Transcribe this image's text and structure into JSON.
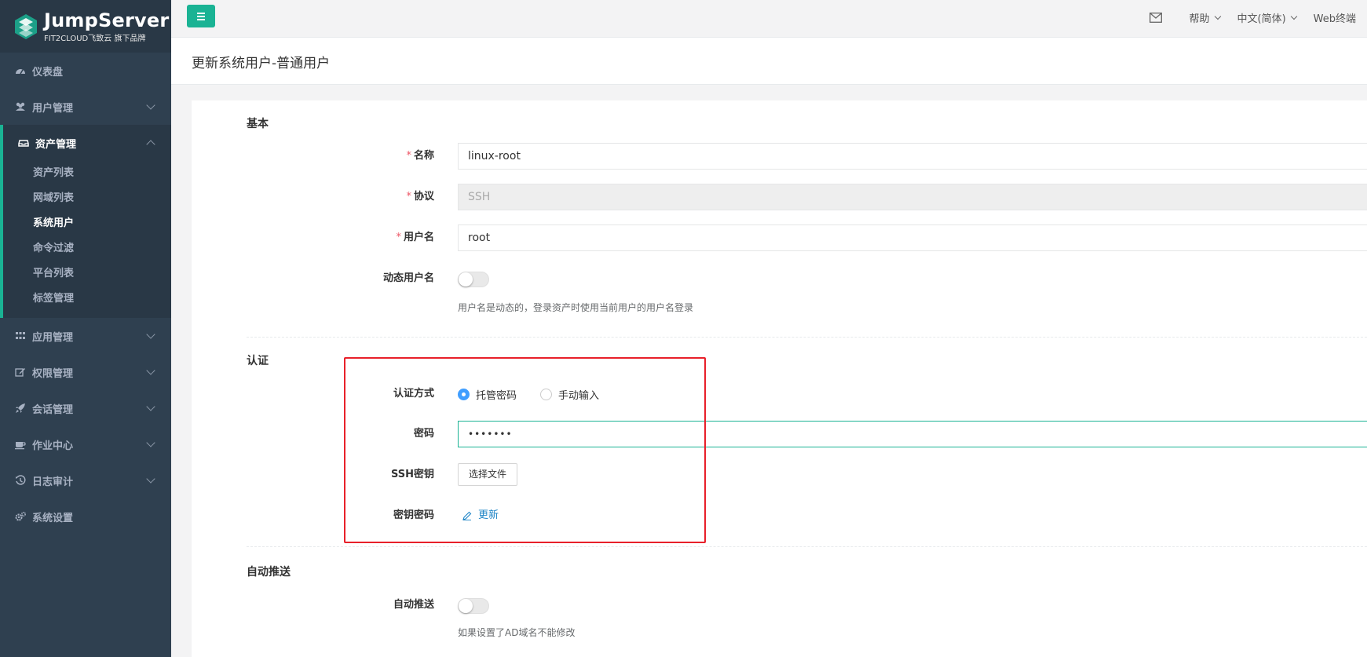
{
  "brand": {
    "title": "JumpServer",
    "subtitle": "FIT2CLOUD飞致云 旗下品牌"
  },
  "sidebar": {
    "items": [
      {
        "label": "仪表盘",
        "icon": "dashboard-icon"
      },
      {
        "label": "用户管理",
        "icon": "users-icon"
      },
      {
        "label": "资产管理",
        "icon": "inbox-icon",
        "expanded": true,
        "children": [
          "资产列表",
          "网域列表",
          "系统用户",
          "命令过滤",
          "平台列表",
          "标签管理"
        ],
        "active_child": "系统用户"
      },
      {
        "label": "应用管理",
        "icon": "grid-icon"
      },
      {
        "label": "权限管理",
        "icon": "edit-icon"
      },
      {
        "label": "会话管理",
        "icon": "rocket-icon"
      },
      {
        "label": "作业中心",
        "icon": "coffee-icon"
      },
      {
        "label": "日志审计",
        "icon": "history-icon"
      },
      {
        "label": "系统设置",
        "icon": "gears-icon"
      }
    ]
  },
  "topbar": {
    "help": "帮助",
    "language": "中文(简体)",
    "web_terminal": "Web终端"
  },
  "page_title": "更新系统用户-普通用户",
  "form": {
    "basic": {
      "title": "基本",
      "name_label": "名称",
      "name_value": "linux-root",
      "protocol_label": "协议",
      "protocol_value": "SSH",
      "username_label": "用户名",
      "username_value": "root",
      "dynamic_label": "动态用户名",
      "dynamic_enabled": false,
      "dynamic_help": "用户名是动态的，登录资产时使用当前用户的用户名登录"
    },
    "auth": {
      "title": "认证",
      "method_label": "认证方式",
      "method_options": [
        "托管密码",
        "手动输入"
      ],
      "method_selected": "托管密码",
      "password_label": "密码",
      "password_value": "•••••••",
      "ssh_key_label": "SSH密钥",
      "ssh_key_button": "选择文件",
      "key_password_label": "密钥密码",
      "key_password_link": "更新"
    },
    "push": {
      "title": "自动推送",
      "push_label": "自动推送",
      "push_enabled": false,
      "push_help": "如果设置了AD域名不能修改"
    }
  },
  "colors": {
    "sidebar": "#2f4050",
    "accent": "#1ab394",
    "highlight_box": "#e8202a",
    "required": "#ed5565",
    "link": "#1c84c6"
  }
}
